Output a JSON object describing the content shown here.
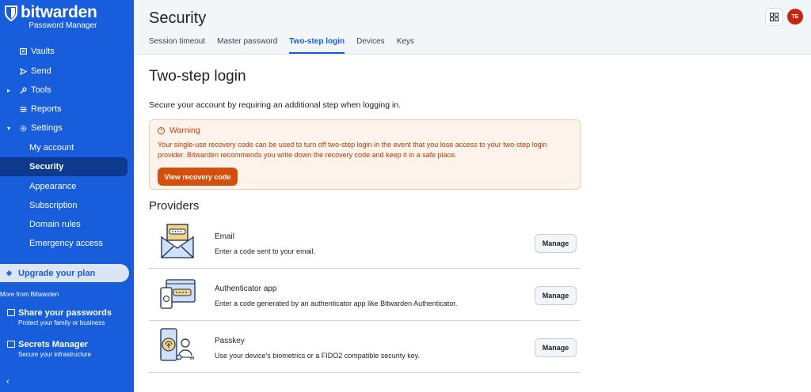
{
  "brand": {
    "name": "bitwarden",
    "subtitle": "Password Manager"
  },
  "sidebar": {
    "items": [
      {
        "label": "Vaults",
        "icon": "vault-icon"
      },
      {
        "label": "Send",
        "icon": "send-icon"
      },
      {
        "label": "Tools",
        "icon": "wrench-icon"
      },
      {
        "label": "Reports",
        "icon": "sliders-icon"
      },
      {
        "label": "Settings",
        "icon": "gear-icon"
      }
    ],
    "settings_children": [
      "My account",
      "Security",
      "Appearance",
      "Subscription",
      "Domain rules",
      "Emergency access"
    ],
    "upgrade_label": "Upgrade your plan",
    "more_from": "More from Bitwarden",
    "products": [
      {
        "title": "Share your passwords",
        "subtitle": "Protect your family or business"
      },
      {
        "title": "Secrets Manager",
        "subtitle": "Secure your infrastructure"
      }
    ]
  },
  "header": {
    "title": "Security",
    "tabs": [
      "Session timeout",
      "Master password",
      "Two-step login",
      "Devices",
      "Keys"
    ],
    "active_tab": "Two-step login",
    "avatar_initials": "TE"
  },
  "main": {
    "title": "Two-step login",
    "intro": "Secure your account by requiring an additional step when logging in.",
    "warning": {
      "title": "Warning",
      "body": "Your single-use recovery code can be used to turn off two-step login in the event that you lose access to your two-step login provider. Bitwarden recommends you write down the recovery code and keep it in a safe place.",
      "button": "View recovery code"
    },
    "providers_title": "Providers",
    "providers": [
      {
        "name": "Email",
        "description": "Enter a code sent to your email.",
        "button": "Manage"
      },
      {
        "name": "Authenticator app",
        "description": "Enter a code generated by an authenticator app like Bitwarden Authenticator.",
        "button": "Manage"
      },
      {
        "name": "Passkey",
        "description": "Use your device's biometrics or a FIDO2 compatible security key.",
        "button": "Manage"
      }
    ]
  },
  "colors": {
    "brand_blue": "#175ddc",
    "sidebar_active": "#0d3a8c",
    "warning_bg": "#fff4ec",
    "warning_text": "#c2410c",
    "warning_button": "#d44f0c",
    "avatar": "#c42710"
  }
}
